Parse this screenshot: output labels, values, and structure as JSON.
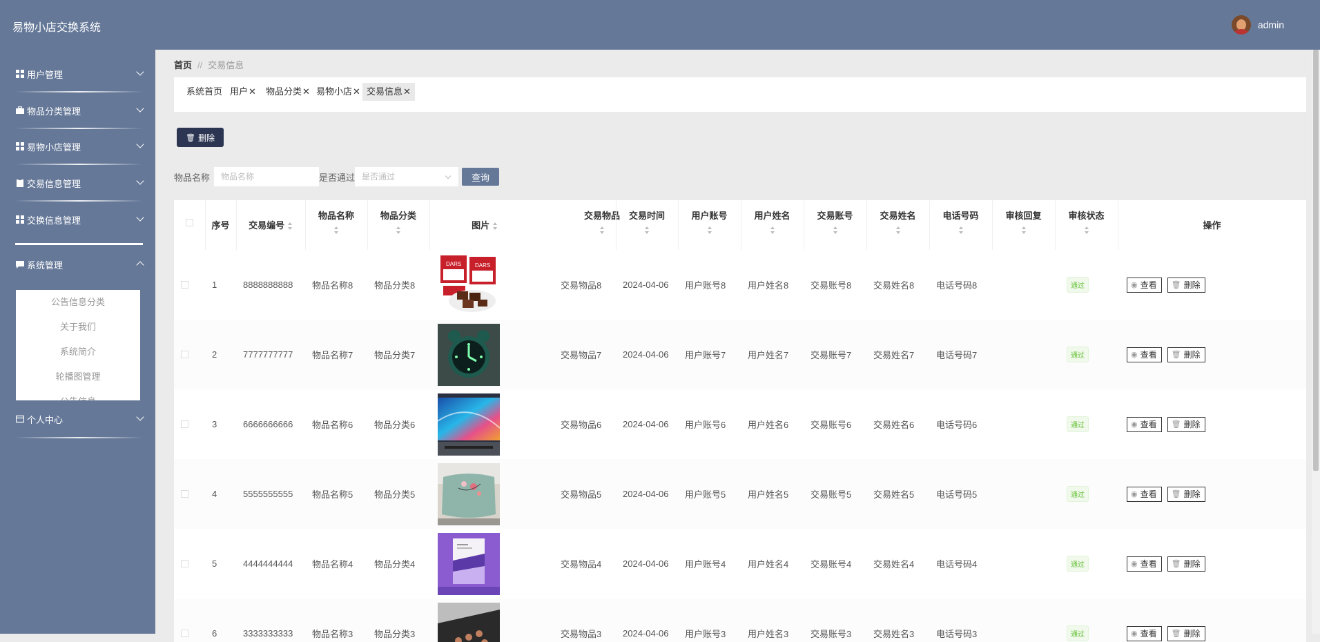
{
  "header": {
    "title": "易物小店交换系统",
    "username": "admin"
  },
  "sidebar": {
    "items": [
      {
        "label": "用户管理",
        "icon": "grid-icon"
      },
      {
        "label": "物品分类管理",
        "icon": "briefcase-icon"
      },
      {
        "label": "易物小店管理",
        "icon": "grid-icon"
      },
      {
        "label": "交易信息管理",
        "icon": "clipboard-icon"
      },
      {
        "label": "交换信息管理",
        "icon": "grid-icon"
      },
      {
        "label": "系统管理",
        "icon": "message-icon"
      },
      {
        "label": "个人中心",
        "icon": "card-icon"
      }
    ],
    "submenu": [
      "公告信息分类",
      "关于我们",
      "系统简介",
      "轮播图管理",
      "公告信息"
    ]
  },
  "breadcrumb": {
    "home": "首页",
    "separator": "//",
    "current": "交易信息"
  },
  "tabs": [
    "系统首页",
    "用户",
    "物品分类",
    "易物小店",
    "交易信息"
  ],
  "toolbar": {
    "delete_label": "删除"
  },
  "search": {
    "name_label": "物品名称",
    "name_placeholder": "物品名称",
    "pass_label": "是否通过",
    "pass_placeholder": "是否通过",
    "query_label": "查询"
  },
  "table": {
    "columns": [
      "序号",
      "交易编号",
      "物品名称",
      "物品分类",
      "图片",
      "交易物品",
      "交易时间",
      "用户账号",
      "用户姓名",
      "交易账号",
      "交易姓名",
      "电话号码",
      "审核回复",
      "审核状态",
      "操作"
    ],
    "rows": [
      {
        "no": "1",
        "code": "8888888888",
        "name": "物品名称8",
        "category": "物品分类8",
        "image": "chocolate-image",
        "item": "交易物品8",
        "time": "2024-04-06",
        "user_account": "用户账号8",
        "user_name": "用户姓名8",
        "trade_account": "交易账号8",
        "trade_name": "交易姓名8",
        "phone": "电话号码8",
        "reply": "",
        "status": "通过"
      },
      {
        "no": "2",
        "code": "7777777777",
        "name": "物品名称7",
        "category": "物品分类7",
        "image": "alarm-clock-image",
        "item": "交易物品7",
        "time": "2024-04-06",
        "user_account": "用户账号7",
        "user_name": "用户姓名7",
        "trade_account": "交易账号7",
        "trade_name": "交易姓名7",
        "phone": "电话号码7",
        "reply": "",
        "status": "通过"
      },
      {
        "no": "3",
        "code": "6666666666",
        "name": "物品名称6",
        "category": "物品分类6",
        "image": "tv-image",
        "item": "交易物品6",
        "time": "2024-04-06",
        "user_account": "用户账号6",
        "user_name": "用户姓名6",
        "trade_account": "交易账号6",
        "trade_name": "交易姓名6",
        "phone": "电话号码6",
        "reply": "",
        "status": "通过"
      },
      {
        "no": "4",
        "code": "5555555555",
        "name": "物品名称5",
        "category": "物品分类5",
        "image": "pillow-image",
        "item": "交易物品5",
        "time": "2024-04-06",
        "user_account": "用户账号5",
        "user_name": "用户姓名5",
        "trade_account": "交易账号5",
        "trade_name": "交易姓名5",
        "phone": "电话号码5",
        "reply": "",
        "status": "通过"
      },
      {
        "no": "5",
        "code": "4444444444",
        "name": "物品名称4",
        "category": "物品分类4",
        "image": "book-image",
        "item": "交易物品4",
        "time": "2024-04-06",
        "user_account": "用户账号4",
        "user_name": "用户姓名4",
        "trade_account": "交易账号4",
        "trade_name": "交易姓名4",
        "phone": "电话号码4",
        "reply": "",
        "status": "通过"
      },
      {
        "no": "6",
        "code": "3333333333",
        "name": "物品名称3",
        "category": "物品分类3",
        "image": "keyboard-image",
        "item": "交易物品3",
        "time": "2024-04-06",
        "user_account": "用户账号3",
        "user_name": "用户姓名3",
        "trade_account": "交易账号3",
        "trade_name": "交易姓名3",
        "phone": "电话号码3",
        "reply": "",
        "status": "通过"
      }
    ],
    "actions": {
      "view": "查看",
      "delete": "删除"
    }
  },
  "colors": {
    "primary": "#657898",
    "dark_button": "#2c3653",
    "success": "#67c23a"
  }
}
